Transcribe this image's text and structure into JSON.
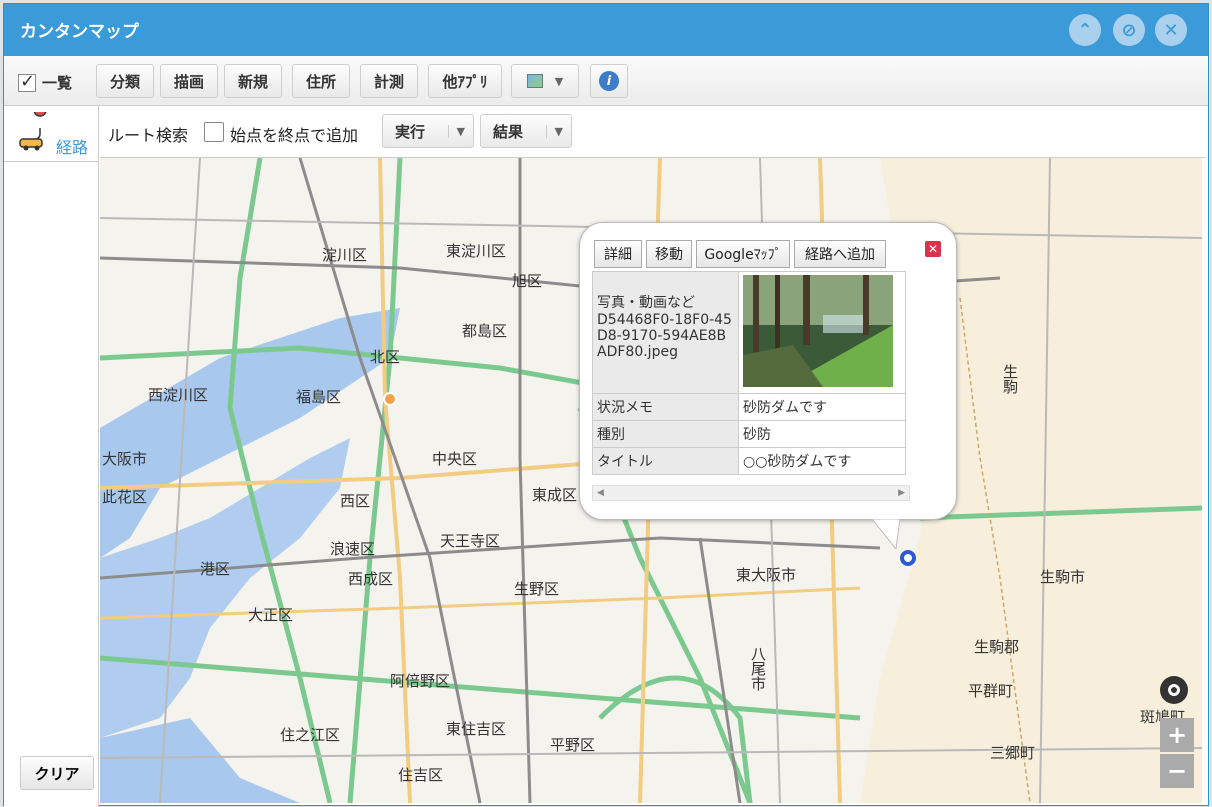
{
  "window": {
    "title": "カンタンマップ"
  },
  "toolbar": {
    "list_label": "一覧",
    "list_checked": true,
    "buttons": [
      "分類",
      "描画",
      "新規",
      "住所",
      "計測",
      "他ｱﾌﾟﾘ"
    ]
  },
  "sidebar": {
    "route_label": "経路",
    "clear_label": "クリア"
  },
  "routebar": {
    "title": "ルート検索",
    "checkbox_label": "始点を終点で追加",
    "run_label": "実行",
    "result_label": "結果"
  },
  "popup": {
    "buttons": [
      "詳細",
      "移動",
      "Googleﾏｯﾌﾟ",
      "経路へ追加"
    ],
    "photo_label": "写真・動画など",
    "photo_filename": "D54468F0-18F0-45D8-9170-594AE8BADF80.jpeg",
    "rows": [
      {
        "key": "状況メモ",
        "value": "砂防ダムです"
      },
      {
        "key": "種別",
        "value": "砂防"
      },
      {
        "key": "タイトル",
        "value": "○○砂防ダムです"
      }
    ]
  },
  "map": {
    "labels": [
      "淀川区",
      "東淀川区",
      "旭区",
      "都島区",
      "北区",
      "福島区",
      "西淀川区",
      "大阪市",
      "此花区",
      "西区",
      "中央区",
      "東成区",
      "浪速区",
      "天王寺区",
      "生野区",
      "港区",
      "大正区",
      "西成区",
      "阿倍野区",
      "東住吉区",
      "平野区",
      "住之江区",
      "住吉区",
      "東大阪市",
      "八尾市",
      "生駒市",
      "生駒郡",
      "平群町",
      "三郷町",
      "斑鳩町",
      "生駒"
    ],
    "controls": {
      "zoom_in": "+",
      "zoom_out": "−"
    }
  },
  "colors": {
    "titlebar": "#3b9ad8",
    "water": "#a9c8ee",
    "road_major": "#7cc98f",
    "road_secondary": "#f2cc82",
    "rail": "#8c8c8c"
  }
}
